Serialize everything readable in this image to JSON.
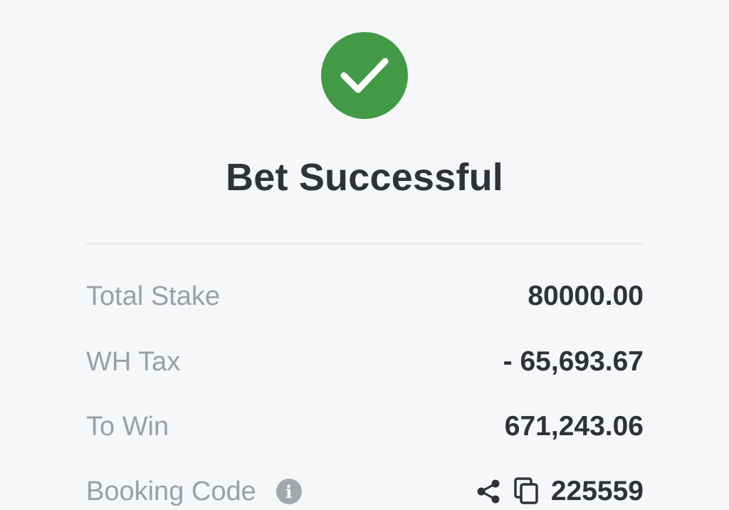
{
  "status": {
    "icon": "check-circle-icon",
    "color": "#429a46",
    "title": "Bet Successful"
  },
  "details": {
    "total_stake": {
      "label": "Total Stake",
      "value": "80000.00"
    },
    "wh_tax": {
      "label": "WH Tax",
      "value": "- 65,693.67"
    },
    "to_win": {
      "label": "To Win",
      "value": "671,243.06"
    },
    "booking_code": {
      "label": "Booking Code",
      "info_icon": "info-icon",
      "share_icon": "share-icon",
      "copy_icon": "copy-icon",
      "value": "225559"
    }
  }
}
